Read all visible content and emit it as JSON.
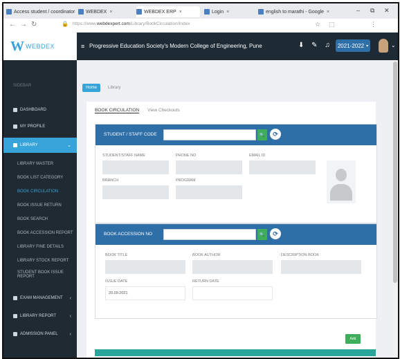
{
  "browser": {
    "tabs": [
      {
        "label": "Access student / coordinator",
        "active": false
      },
      {
        "label": "WEBDEX",
        "active": false
      },
      {
        "label": "WEBDEX ERP",
        "active": true
      },
      {
        "label": "Login",
        "active": false
      },
      {
        "label": "english to marathi - Google",
        "active": false
      }
    ],
    "url_prefix": "https://www.",
    "url_domain": "webdexpert.com",
    "url_rest": "/Library/BookCirculation/Index",
    "window_min": "–",
    "window_max": "⧉",
    "window_close": "✕"
  },
  "app": {
    "logo_mark": "W",
    "logo_text": "WEBDEX",
    "college_name": "Progressive Education Society's Modern College of Engineering, Pune",
    "academic_year": "2021-2022",
    "academic_year_caret": "▾"
  },
  "sidebar": {
    "heading": "SIDEBAR",
    "items": [
      {
        "label": "DASHBOARD",
        "type": "main"
      },
      {
        "label": "MY PROFILE",
        "type": "main"
      },
      {
        "label": "LIBRARY",
        "type": "active"
      },
      {
        "label": "LIBRARY MASTER",
        "type": "sub"
      },
      {
        "label": "BOOK LIST CATEGORY",
        "type": "sub"
      },
      {
        "label": "BOOK CIRCULATION",
        "type": "sub"
      },
      {
        "label": "BOOK ISSUE RETURN",
        "type": "sub"
      },
      {
        "label": "BOOK SEARCH",
        "type": "sub"
      },
      {
        "label": "BOOK ACCESSION REPORT",
        "type": "sub"
      },
      {
        "label": "LIBRARY FINE DETAILS",
        "type": "sub"
      },
      {
        "label": "LIBRARY STOCK REPORT",
        "type": "sub"
      },
      {
        "label": "STUDENT BOOK ISSUE REPORT",
        "type": "sub"
      },
      {
        "label": "EXAM MANAGEMENT",
        "type": "main"
      },
      {
        "label": "LIBRARY REPORT",
        "type": "main"
      },
      {
        "label": "ADMISSION PANEL",
        "type": "main"
      }
    ]
  },
  "breadcrumbs": [
    "Home",
    "Library"
  ],
  "page_tabs": {
    "active": "BOOK CIRCULATION",
    "other": "View Checkouts"
  },
  "student_section": {
    "title": "STUDENT / STAFF CODE",
    "search_placeholder": "",
    "search_icon": "🔍",
    "clear_icon": "⟳",
    "fields": [
      {
        "label": "STUDENT/STAFF NAME",
        "value": ""
      },
      {
        "label": "PHONE NO",
        "value": ""
      },
      {
        "label": "EMAIL ID",
        "value": ""
      },
      {
        "label": "BRANCH",
        "value": ""
      },
      {
        "label": "PROGRAM",
        "value": ""
      }
    ]
  },
  "book_section": {
    "title": "BOOK ACCESSION NO",
    "search_placeholder": "",
    "search_icon": "🔍",
    "clear_icon": "⟳",
    "fields": [
      {
        "label": "BOOK TITLE",
        "value": ""
      },
      {
        "label": "BOOK AUTHOR",
        "value": ""
      },
      {
        "label": "DESCRIPTION BOOK",
        "value": ""
      },
      {
        "label": "ISSUE DATE",
        "value": "20.09.2021"
      },
      {
        "label": "RETURN DATE",
        "value": ""
      }
    ],
    "add_label": "Add"
  }
}
